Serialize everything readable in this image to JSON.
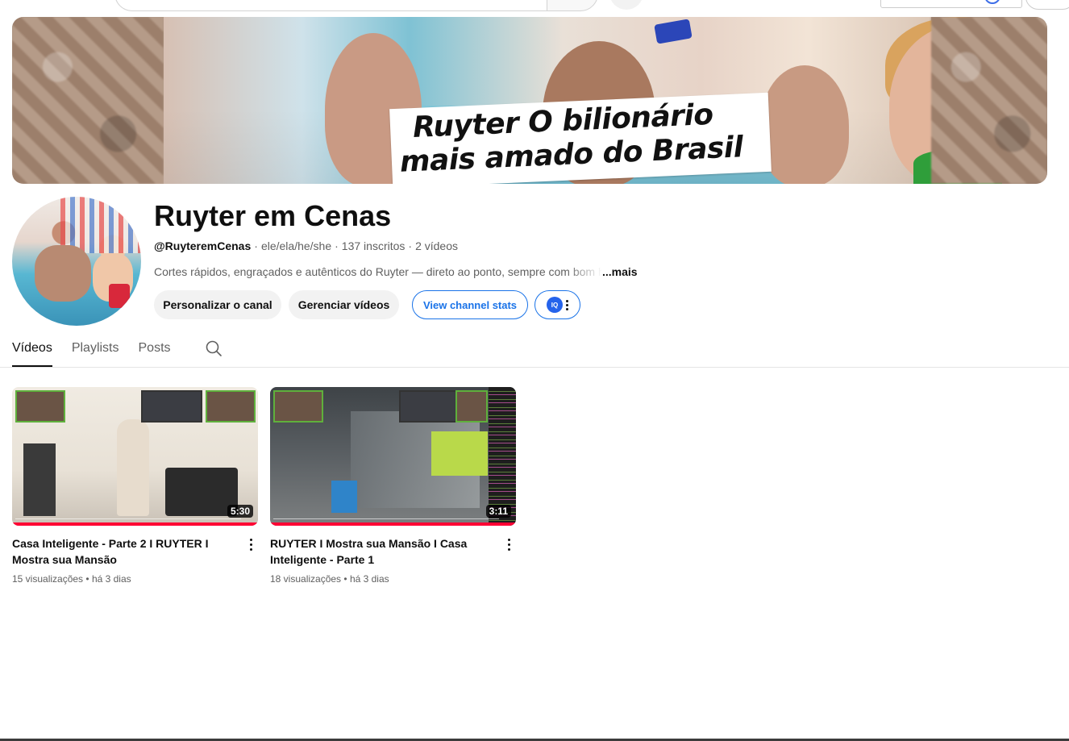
{
  "banner": {
    "caption_line1": "Ruyter  O bilionário",
    "caption_line2": "mais amado do Brasil"
  },
  "channel": {
    "name": "Ruyter em Cenas",
    "handle": "@RuyteremCenas",
    "pronouns": "ele/ela/he/she",
    "subscribers": "137 inscritos",
    "video_count": "2 vídeos",
    "description": "Cortes rápidos, engraçados e autênticos do Ruyter — direto ao ponto, sempre com bom h",
    "more_label": "...mais"
  },
  "buttons": {
    "customize": "Personalizar o canal",
    "manage": "Gerenciar vídeos",
    "stats": "View channel stats",
    "ext_icon_label": "IQ"
  },
  "tabs": [
    {
      "label": "Vídeos",
      "active": true
    },
    {
      "label": "Playlists",
      "active": false
    },
    {
      "label": "Posts",
      "active": false
    }
  ],
  "videos": [
    {
      "title": "Casa Inteligente - Parte 2 I RUYTER I Mostra sua Mansão",
      "duration": "5:30",
      "views": "15 visualizações",
      "age": "há 3 dias"
    },
    {
      "title": "RUYTER I Mostra sua Mansão I Casa Inteligente - Parte 1",
      "duration": "3:11",
      "views": "18 visualizações",
      "age": "há 3 dias"
    }
  ],
  "colors": {
    "accent_blue": "#1a73e8",
    "progress_red": "#ff0033",
    "text_primary": "#0f0f0f",
    "text_secondary": "#606060"
  },
  "icons": {
    "search": "search-icon",
    "more": "more-vert-icon",
    "extension": "iq-extension-icon"
  }
}
